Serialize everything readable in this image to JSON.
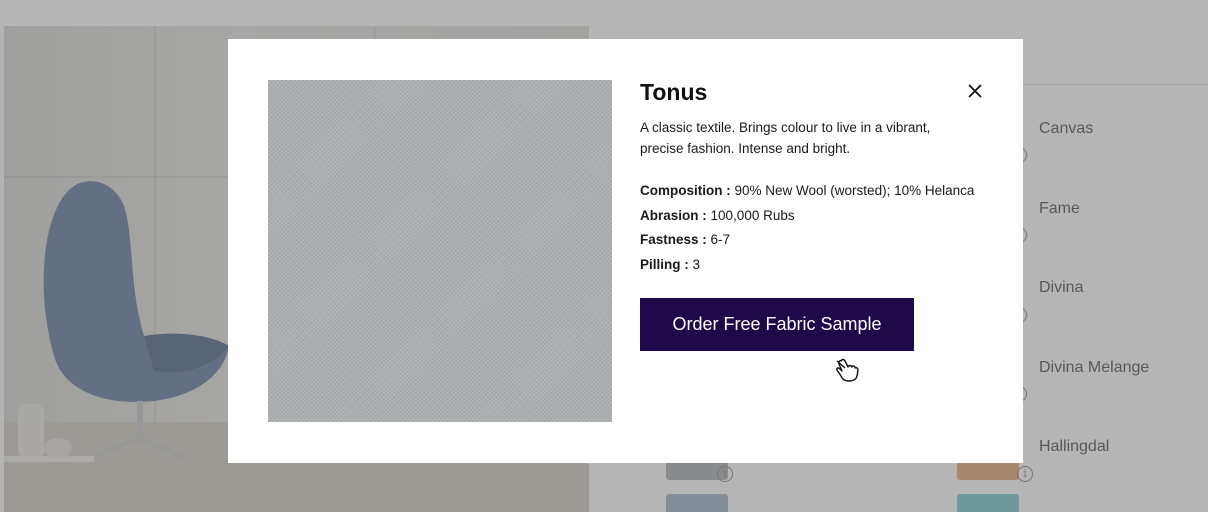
{
  "modal": {
    "title": "Tonus",
    "description": "A classic textile. Brings colour to live in a vibrant, precise fashion. Intense and bright.",
    "specs": [
      {
        "label": "Composition :",
        "value": "90% New Wool (worsted); 10% Helanca"
      },
      {
        "label": "Abrasion :",
        "value": "100,000 Rubs"
      },
      {
        "label": "Fastness :",
        "value": "6-7"
      },
      {
        "label": "Pilling :",
        "value": "3"
      }
    ],
    "order_button_label": "Order Free Fabric Sample",
    "close_icon": "close-icon",
    "cursor_icon": "hand-pointer-icon"
  },
  "fabrics": [
    {
      "name": "Canvas"
    },
    {
      "name": "Fame"
    },
    {
      "name": "Divina"
    },
    {
      "name": "Divina Melange"
    },
    {
      "name": "Hallingdal"
    }
  ],
  "colors": {
    "order_button_bg": "#1e0a4a",
    "overlay": "rgba(60,60,60,0.38)",
    "fabric_swatch": "#a9aeaf"
  }
}
